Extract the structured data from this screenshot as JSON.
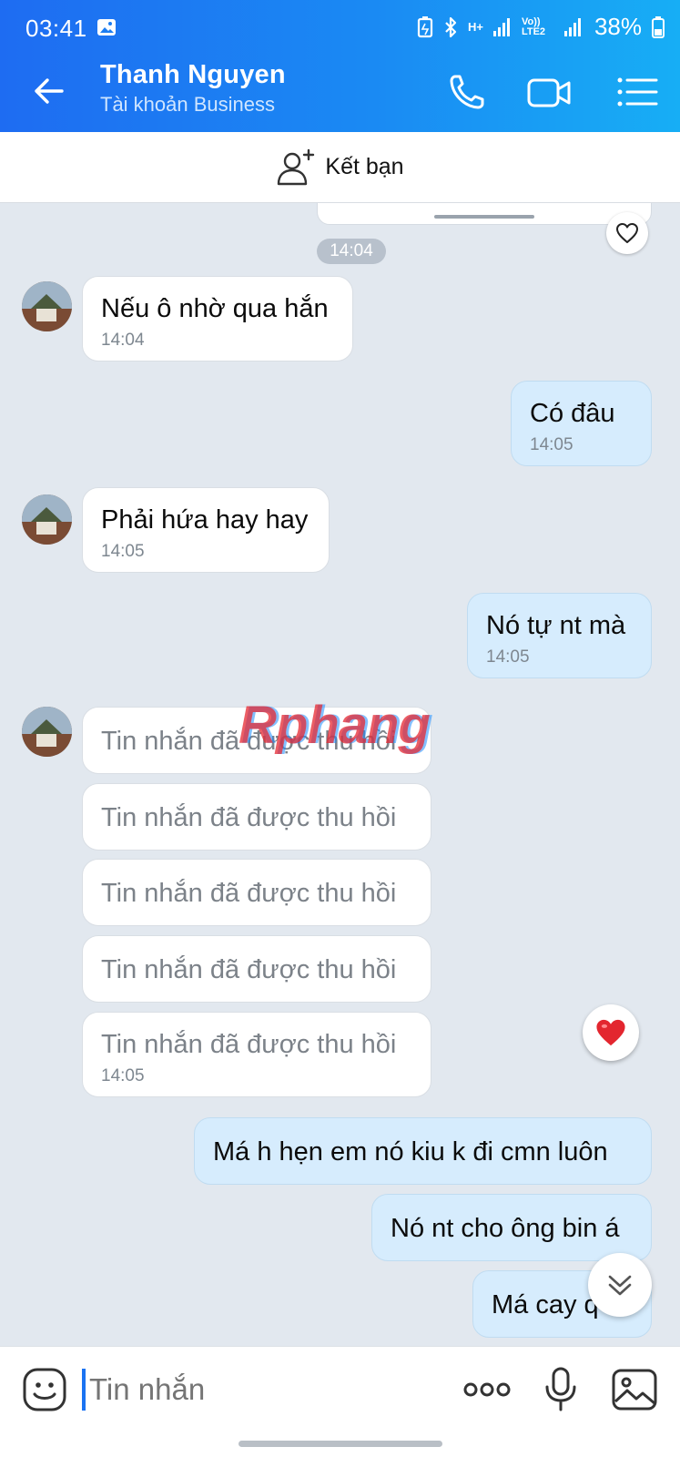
{
  "status_bar": {
    "time": "03:41",
    "network_label": "H+",
    "volte_label": "Vo)) LTE2",
    "battery_percent": "38%"
  },
  "header": {
    "contact_name": "Thanh Nguyen",
    "subtitle": "Tài khoản Business",
    "icons": [
      "back-arrow-icon",
      "phone-icon",
      "video-camera-icon",
      "menu-list-icon"
    ],
    "color": "#1a8af3"
  },
  "friend_bar": {
    "label": "Kết bạn",
    "icon": "add-person-icon"
  },
  "chat": {
    "time_separator": "14:04",
    "messages": [
      {
        "dir": "in",
        "text": "Nếu ô nhờ qua hắn",
        "time": "14:04",
        "avatar": true
      },
      {
        "dir": "out",
        "text": "Có đâu",
        "time": "14:05"
      },
      {
        "dir": "in",
        "text": "Phải hứa hay hay",
        "time": "14:05",
        "avatar": true
      },
      {
        "dir": "out",
        "text": "Nó tự nt mà",
        "time": "14:05"
      },
      {
        "dir": "in",
        "text": "Tin nhắn đã được thu hồi",
        "recalled": true,
        "avatar": true
      },
      {
        "dir": "in",
        "text": "Tin nhắn đã được thu hồi",
        "recalled": true
      },
      {
        "dir": "in",
        "text": "Tin nhắn đã được thu hồi",
        "recalled": true
      },
      {
        "dir": "in",
        "text": "Tin nhắn đã được thu hồi",
        "recalled": true
      },
      {
        "dir": "in",
        "text": "Tin nhắn đã được thu hồi",
        "recalled": true,
        "time": "14:05"
      },
      {
        "dir": "out",
        "text": "Má h hẹn em nó kiu k đi cmn luôn"
      },
      {
        "dir": "out",
        "text": "Nó nt cho ông bin á"
      },
      {
        "dir": "out",
        "text": "Má cay q"
      }
    ],
    "reaction": "heart-filled-icon",
    "watermark": "Rphang"
  },
  "composer": {
    "placeholder": "Tin nhắn",
    "icons": [
      "emoji-icon",
      "more-dots-icon",
      "microphone-icon",
      "gallery-icon"
    ]
  }
}
